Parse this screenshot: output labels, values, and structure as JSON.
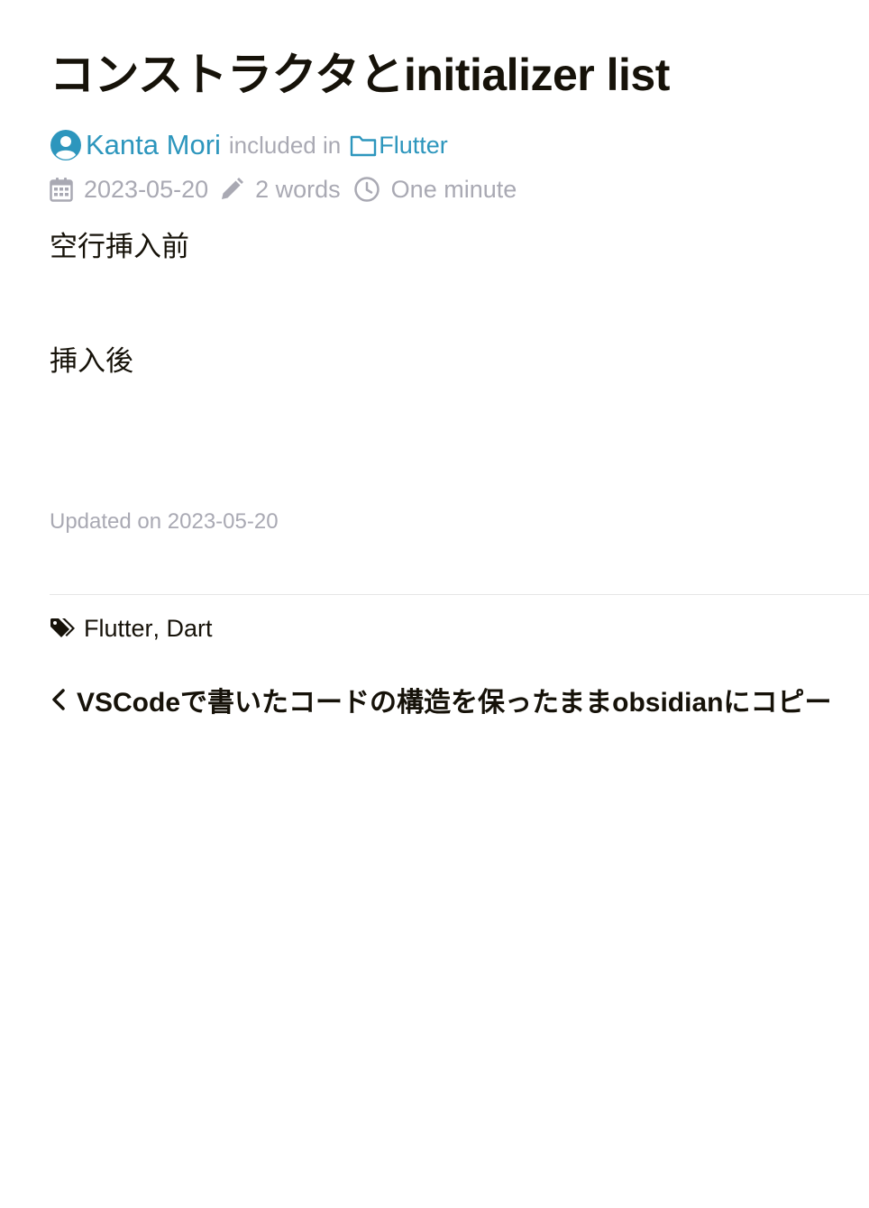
{
  "post": {
    "title": "コンストラクタとinitializer list",
    "author": "Kanta Mori",
    "included_in": "included in",
    "category": "Flutter",
    "date": "2023-05-20",
    "word_count": "2 words",
    "reading_time": "One minute",
    "paragraphs": [
      "空行挿入前",
      "挿入後"
    ],
    "updated": "Updated on 2023-05-20"
  },
  "footer": {
    "tags": [
      "Flutter",
      "Dart"
    ],
    "tag_separator": ", ",
    "prev_post": "VSCodeで書いたコードの構造を保ったままobsidianにコピー"
  },
  "icons": {
    "author": "user-circle-icon",
    "category": "folder-icon",
    "date": "calendar-icon",
    "words": "pencil-icon",
    "time": "clock-icon",
    "tags": "tags-icon",
    "prev": "chevron-left-icon"
  },
  "colors": {
    "text": "#161209",
    "link": "#2d96bd",
    "muted": "#a9a9b3",
    "divider": "#e6e6e6",
    "background": "#ffffff"
  }
}
